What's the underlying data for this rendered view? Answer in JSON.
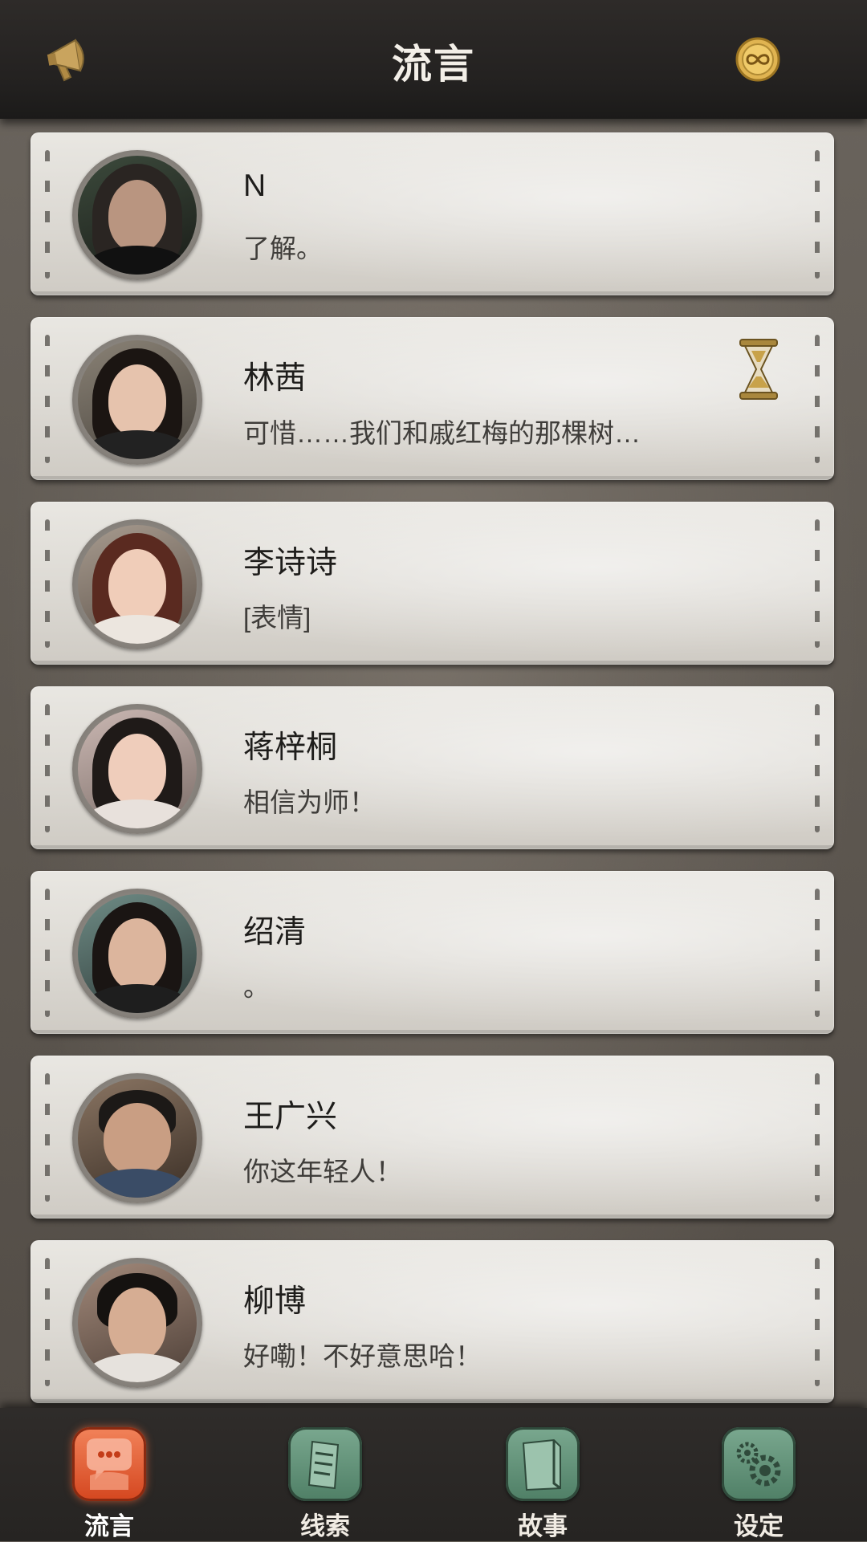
{
  "header": {
    "title": "流言",
    "left_icon": "megaphone-icon",
    "right_icon": "infinity-coin-icon"
  },
  "chats": [
    {
      "name": "N",
      "message": "了解。",
      "pending": false
    },
    {
      "name": "林茜",
      "message": "可惜……我们和戚红梅的那棵树…",
      "pending": true
    },
    {
      "name": "李诗诗",
      "message": "[表情]",
      "pending": false
    },
    {
      "name": "蒋梓桐",
      "message": "相信为师！",
      "pending": false
    },
    {
      "name": "绍清",
      "message": "。",
      "pending": false
    },
    {
      "name": "王广兴",
      "message": "你这年轻人！",
      "pending": false
    },
    {
      "name": "柳博",
      "message": "好嘞！不好意思哈！",
      "pending": false
    }
  ],
  "tabs": [
    {
      "label": "流言",
      "icon": "chat-bubble-icon",
      "active": true
    },
    {
      "label": "线索",
      "icon": "notes-icon",
      "active": false
    },
    {
      "label": "故事",
      "icon": "book-icon",
      "active": false
    },
    {
      "label": "设定",
      "icon": "gear-icon",
      "active": false
    }
  ],
  "colors": {
    "active_tab": "#e0582d",
    "inactive_tab": "#5f8f75",
    "header_bg": "#262422",
    "card_bg": "#dedbd5"
  }
}
